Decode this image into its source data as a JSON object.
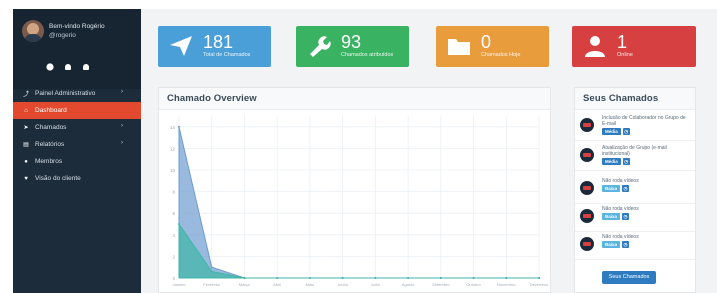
{
  "profile": {
    "welcome": "Bem-vindo Rogério",
    "handle": "@rogerio",
    "icons": [
      "gear-icon",
      "bell-icon",
      "user-icon"
    ]
  },
  "menu": [
    {
      "label": "Painel Administrativo",
      "icon": "wrench-icon",
      "arrow": true,
      "active": false
    },
    {
      "label": "Dashboard",
      "icon": "home-icon",
      "arrow": false,
      "active": true
    },
    {
      "label": "Chamados",
      "icon": "paper-plane-icon",
      "arrow": true,
      "active": false
    },
    {
      "label": "Relatórios",
      "icon": "report-icon",
      "arrow": true,
      "active": false
    },
    {
      "label": "Membros",
      "icon": "user-icon",
      "arrow": false,
      "active": false
    },
    {
      "label": "Visão do cliente",
      "icon": "heart-icon",
      "arrow": false,
      "active": false
    }
  ],
  "cards": [
    {
      "value": "181",
      "label": "Total de Chamados",
      "icon": "paper-plane-icon",
      "color": "#4b9fd8"
    },
    {
      "value": "93",
      "label": "Chamados atribuídos",
      "icon": "wrench-icon",
      "color": "#39b262"
    },
    {
      "value": "0",
      "label": "Chamados Hoje",
      "icon": "folder-icon",
      "color": "#e99c3c"
    },
    {
      "value": "1",
      "label": "Online",
      "icon": "user-icon",
      "color": "#d64040"
    }
  ],
  "overview": {
    "title": "Chamado Overview"
  },
  "chart_data": {
    "type": "area",
    "title": "Chamado Overview",
    "categories": [
      "Janeiro",
      "Fevereiro",
      "Março",
      "Abril",
      "Maio",
      "Junho",
      "Julho",
      "Agosto",
      "Setembro",
      "Outubro",
      "Novembro",
      "Dezembro"
    ],
    "series": [
      {
        "values": [
          14,
          1,
          0,
          0,
          0,
          0,
          0,
          0,
          0,
          0,
          0,
          0
        ],
        "color": "#6d9bd0"
      },
      {
        "values": [
          5,
          0.6,
          0,
          0,
          0,
          0,
          0,
          0,
          0,
          0,
          0,
          0
        ],
        "color": "#3fb7a8"
      }
    ],
    "yticks": [
      0,
      2,
      4,
      6,
      8,
      10,
      12,
      14
    ],
    "ylim": [
      0,
      15
    ],
    "grid": true
  },
  "tickets_panel": {
    "title": "Seus Chamados",
    "button": "Seus Chamados",
    "items": [
      {
        "title": "Inclusão de Colaborador no Grupo de E-mail",
        "priority": "Média",
        "priority_color": "#2e7bbf"
      },
      {
        "title": "Atualização de Grupo (e-mail institucional)",
        "priority": "Média",
        "priority_color": "#2e7bbf"
      },
      {
        "title": "Não roda vídeos",
        "priority": "Baixa",
        "priority_color": "#5bb3e0"
      },
      {
        "title": "Não roda vídeos",
        "priority": "Baixa",
        "priority_color": "#5bb3e0"
      },
      {
        "title": "Não roda vídeos",
        "priority": "Baixa",
        "priority_color": "#5bb3e0"
      }
    ]
  }
}
